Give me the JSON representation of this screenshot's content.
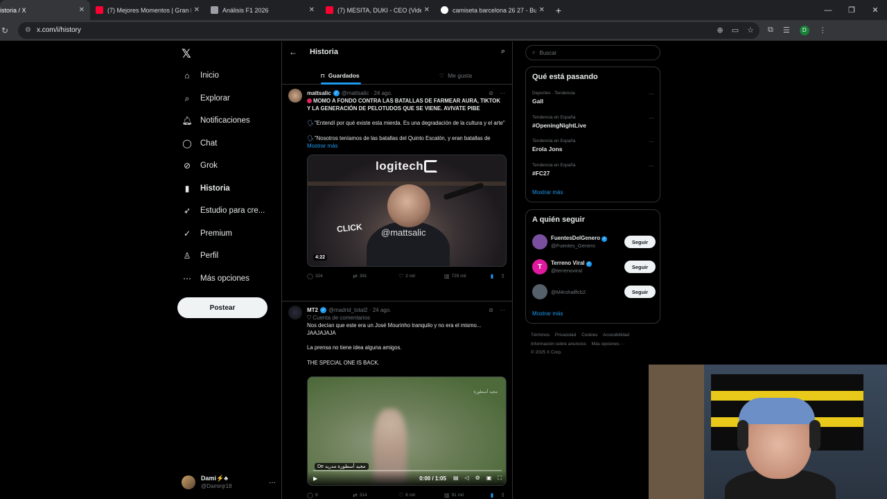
{
  "browser": {
    "tabs": [
      {
        "label": "istoria / X",
        "active": true,
        "color": "#ffffff"
      },
      {
        "label": "(7) Mejores Momentos | Gran P",
        "active": false,
        "color": "#ff0033"
      },
      {
        "label": "Análisis F1 2026",
        "active": false,
        "color": "#9aa0a6"
      },
      {
        "label": "(7) MESITA, DUKI - CEO (Video",
        "active": false,
        "color": "#ff0033"
      },
      {
        "label": "camiseta barcelona 26 27 - Bus",
        "active": false,
        "color": "#4285f4"
      }
    ],
    "url": "x.com/i/history"
  },
  "nav": {
    "items": [
      {
        "label": "Inicio",
        "icon": "home-icon",
        "glyph": "⌂"
      },
      {
        "label": "Explorar",
        "icon": "search-icon",
        "glyph": "⌕"
      },
      {
        "label": "Notificaciones",
        "icon": "bell-icon",
        "glyph": "♫"
      },
      {
        "label": "Chat",
        "icon": "chat-icon",
        "glyph": "◯"
      },
      {
        "label": "Grok",
        "icon": "grok-icon",
        "glyph": "⊘"
      },
      {
        "label": "Historia",
        "icon": "bookmark-icon",
        "glyph": "▮"
      },
      {
        "label": "Estudio para cre...",
        "icon": "rocket-icon",
        "glyph": "➶"
      },
      {
        "label": "Premium",
        "icon": "verified-icon",
        "glyph": "✓"
      },
      {
        "label": "Perfil",
        "icon": "person-icon",
        "glyph": "♙"
      },
      {
        "label": "Más opciones",
        "icon": "more-circle-icon",
        "glyph": "⋯"
      }
    ],
    "post_label": "Postear",
    "account": {
      "name": "Dami⚡️♣",
      "handle": "@Daminjr18"
    }
  },
  "feed": {
    "title": "Historia",
    "tabs": [
      "Guardados",
      "Me gusta"
    ],
    "posts": [
      {
        "name": "mattsalic",
        "handle": "@mattsalic · 24 ago.",
        "headline": "MOMO A FONDO CONTRA LAS BATALLAS DE FARMEAR AURA, TIKTOK Y LA GENERACIÓN DE PELOTUDOS QUE SE VIENE. AVIVATE PIBE",
        "line2": "\"Entendí por qué existe esta mierda. Es una degradación de la cultura y el arte\"",
        "line3": "\"Nosotros teníamos de las batallas del Quinto Escalón, y eran batallas de",
        "show_more": "Mostrar más",
        "media": {
          "brand": "logitech",
          "overlay": "CLICK",
          "watermark": "@mattsalic",
          "duration": "4:22"
        },
        "stats": {
          "replies": "324",
          "reposts": "391",
          "likes": "2 mil",
          "views": "729 mil"
        }
      },
      {
        "name": "MT2",
        "handle": "@madrid_total2 · 24 ago.",
        "sub": "Cuenta de comentarios",
        "line1": "Nos decían que este era un José Mourinho tranquilo y no era el mismo... JAAJAJAJA",
        "line2": "La prensa no tiene idea alguna amigos.",
        "line3": "THE SPECIAL ONE IS BACK.",
        "media": {
          "caption": "De مجيد أسطورة مدريد",
          "watermark": "مجيد أسطورة",
          "time": "0:00 / 1:05"
        },
        "stats": {
          "replies": "9",
          "reposts": "314",
          "likes": "8 mil",
          "views": "91 mil"
        }
      }
    ]
  },
  "right": {
    "search_placeholder": "Buscar",
    "trends_title": "Qué está pasando",
    "trends": [
      {
        "meta": "Deportes · Tendencia",
        "name": "Gall"
      },
      {
        "meta": "Tendencia en España",
        "name": "#OpeningNightLive"
      },
      {
        "meta": "Tendencia en España",
        "name": "Erola Jons"
      },
      {
        "meta": "Tendencia en España",
        "name": "#FC27"
      }
    ],
    "show_more": "Mostrar más",
    "follow_title": "A quién seguir",
    "follow": [
      {
        "name": "FuentesDelGenero",
        "handle": "@Fuentes_Genero",
        "verified": true,
        "color": "#7b4fa0"
      },
      {
        "name": "Terreno Viral",
        "handle": "@terrenoviral",
        "verified": true,
        "color": "#e0199e",
        "letter": "T"
      },
      {
        "name": "",
        "handle": "@M4rshallfcb2",
        "verified": false,
        "color": "#55606b"
      }
    ],
    "follow_btn": "Seguir",
    "footer": [
      "Términos",
      "Privacidad",
      "Cookies",
      "Accesibilidad",
      "Información sobre anuncios",
      "Más opciones ···",
      "© 2025 X Corp."
    ]
  }
}
